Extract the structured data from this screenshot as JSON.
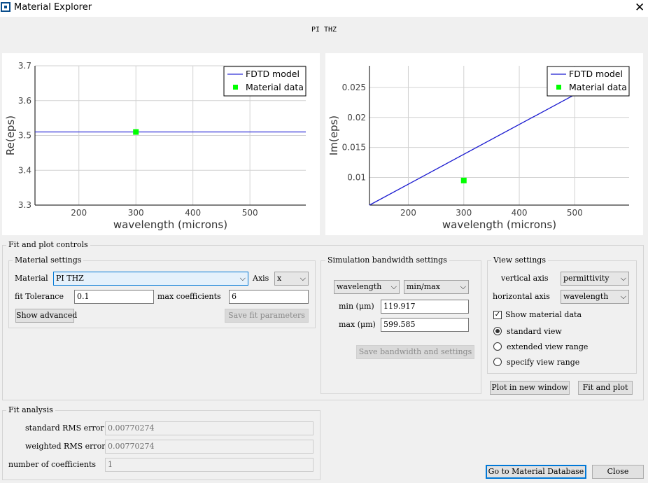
{
  "window": {
    "title": "Material Explorer",
    "close_glyph": "✕"
  },
  "plot_title": "PI THZ",
  "chart_data": [
    {
      "type": "line",
      "xlabel": "wavelength (microns)",
      "ylabel": "Re(eps)",
      "xlim": [
        123,
        598
      ],
      "ylim": [
        3.3,
        3.7
      ],
      "xticks": [
        200,
        300,
        400,
        500
      ],
      "yticks": [
        3.3,
        3.4,
        3.5,
        3.6,
        3.7
      ],
      "xtick_labels": [
        "200",
        "300",
        "400",
        "500"
      ],
      "ytick_labels": [
        "3.3",
        "3.4",
        "3.5",
        "3.6",
        "3.7"
      ],
      "grid": true,
      "legend_position": "top-right",
      "series": [
        {
          "name": "FDTD model",
          "kind": "line",
          "color": "#3232d8",
          "x": [
            123,
            598
          ],
          "y": [
            3.51,
            3.51
          ]
        },
        {
          "name": "Material data",
          "kind": "marker",
          "color": "#00ff00",
          "x": [
            300
          ],
          "y": [
            3.51
          ]
        }
      ]
    },
    {
      "type": "line",
      "xlabel": "wavelength (microns)",
      "ylabel": "Im(eps)",
      "xlim": [
        130,
        598
      ],
      "ylim": [
        0.0054,
        0.0286
      ],
      "xticks": [
        200,
        300,
        400,
        500
      ],
      "yticks": [
        0.01,
        0.015,
        0.02,
        0.025
      ],
      "xtick_labels": [
        "200",
        "300",
        "400",
        "500"
      ],
      "ytick_labels": [
        "0.01",
        "0.015",
        "0.02",
        "0.025"
      ],
      "grid": true,
      "legend_position": "top-right",
      "series": [
        {
          "name": "FDTD model",
          "kind": "line",
          "color": "#1c1cd0",
          "x": [
            130,
            500
          ],
          "y": [
            0.0054,
            0.0238
          ]
        },
        {
          "name": "Material data",
          "kind": "marker",
          "color": "#00ff00",
          "x": [
            300
          ],
          "y": [
            0.0095
          ]
        }
      ]
    }
  ],
  "fit_plot_controls": {
    "legend": "Fit and plot controls",
    "material_settings": {
      "legend": "Material settings",
      "material_label": "Material",
      "material_value": "PI THZ",
      "axis_label": "Axis",
      "axis_value": "x",
      "fit_tolerance_label": "fit Tolerance",
      "fit_tolerance_value": "0.1",
      "max_coefficients_label": "max coefficients",
      "max_coefficients_value": "6",
      "show_advanced": "Show advanced",
      "save_fit": "Save fit parameters"
    },
    "simulation_bandwidth": {
      "legend": "Simulation bandwidth settings",
      "unit_select": "wavelength",
      "range_select": "min/max",
      "min_label": "min (μm)",
      "min_value": "119.917",
      "max_label": "max (μm)",
      "max_value": "599.585",
      "save_button": "Save bandwidth and settings"
    },
    "view_settings": {
      "legend": "View settings",
      "vertical_label": "vertical axis",
      "vertical_value": "permittivity",
      "horizontal_label": "horizontal axis",
      "horizontal_value": "wavelength",
      "show_material_data": "Show material data",
      "show_material_checked": true,
      "radio_standard": "standard view",
      "radio_extended": "extended view range",
      "radio_specify": "specify view range",
      "selected_view": "standard view"
    },
    "plot_new_window": "Plot in new window",
    "fit_and_plot": "Fit and plot"
  },
  "fit_analysis": {
    "legend": "Fit analysis",
    "standard_rms_label": "standard RMS error",
    "standard_rms_value": "0.00770274",
    "weighted_rms_label": "weighted RMS error",
    "weighted_rms_value": "0.00770274",
    "num_coeff_label": "number of coefficients",
    "num_coeff_value": "1"
  },
  "bottom_buttons": {
    "go_database": "Go to Material Database",
    "close": "Close"
  }
}
